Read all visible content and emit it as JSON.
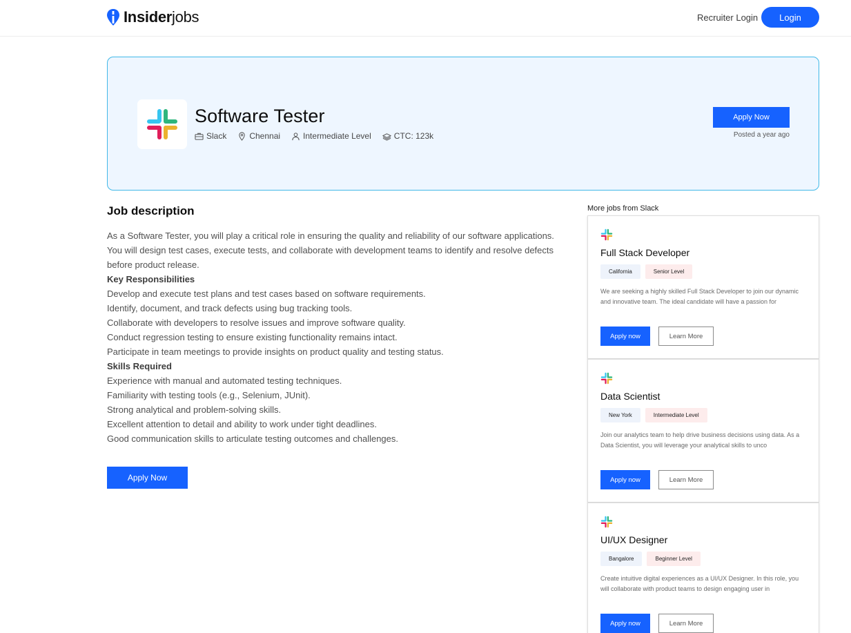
{
  "brand": {
    "bold": "Insider",
    "light": "jobs"
  },
  "nav": {
    "recruiter_login": "Recruiter Login",
    "login": "Login"
  },
  "colors": {
    "accent": "#1662ff",
    "hero_bg": "#eef6ff",
    "hero_border": "#40b8e8",
    "tag_location_bg": "#eef3fb",
    "tag_level_bg": "#fdecec"
  },
  "job": {
    "title": "Software Tester",
    "company": "Slack",
    "location": "Chennai",
    "level": "Intermediate Level",
    "ctc": "CTC: 123k",
    "apply_label": "Apply Now",
    "posted": "Posted a year ago"
  },
  "description": {
    "heading": "Job description",
    "intro": "As a Software Tester, you will play a critical role in ensuring the quality and reliability of our software applications. You will design test cases, execute tests, and collaborate with development teams to identify and resolve defects before product release.",
    "responsibilities_heading": "Key Responsibilities",
    "responsibilities": [
      "Develop and execute test plans and test cases based on software requirements.",
      "Identify, document, and track defects using bug tracking tools.",
      "Collaborate with developers to resolve issues and improve software quality.",
      "Conduct regression testing to ensure existing functionality remains intact.",
      "Participate in team meetings to provide insights on product quality and testing status."
    ],
    "skills_heading": "Skills Required",
    "skills": [
      "Experience with manual and automated testing techniques.",
      "Familiarity with testing tools (e.g., Selenium, JUnit).",
      "Strong analytical and problem-solving skills.",
      "Excellent attention to detail and ability to work under tight deadlines.",
      "Good communication skills to articulate testing outcomes and challenges."
    ],
    "apply_label": "Apply Now"
  },
  "more_jobs": {
    "heading": "More jobs from Slack",
    "items": [
      {
        "title": "Full Stack Developer",
        "location": "California",
        "level": "Senior Level",
        "description": "We are seeking a highly skilled Full Stack Developer to join our dynamic and innovative team. The ideal candidate will have a passion for",
        "apply_label": "Apply now",
        "learn_label": "Learn More"
      },
      {
        "title": "Data Scientist",
        "location": "New York",
        "level": "Intermediate Level",
        "description": "Join our analytics team to help drive business decisions using data. As a Data Scientist, you will leverage your analytical skills to unco",
        "apply_label": "Apply now",
        "learn_label": "Learn More"
      },
      {
        "title": "UI/UX Designer",
        "location": "Bangalore",
        "level": "Beginner Level",
        "description": "Create intuitive digital experiences as a UI/UX Designer. In this role, you will collaborate with product teams to design engaging user in",
        "apply_label": "Apply now",
        "learn_label": "Learn More"
      }
    ]
  }
}
